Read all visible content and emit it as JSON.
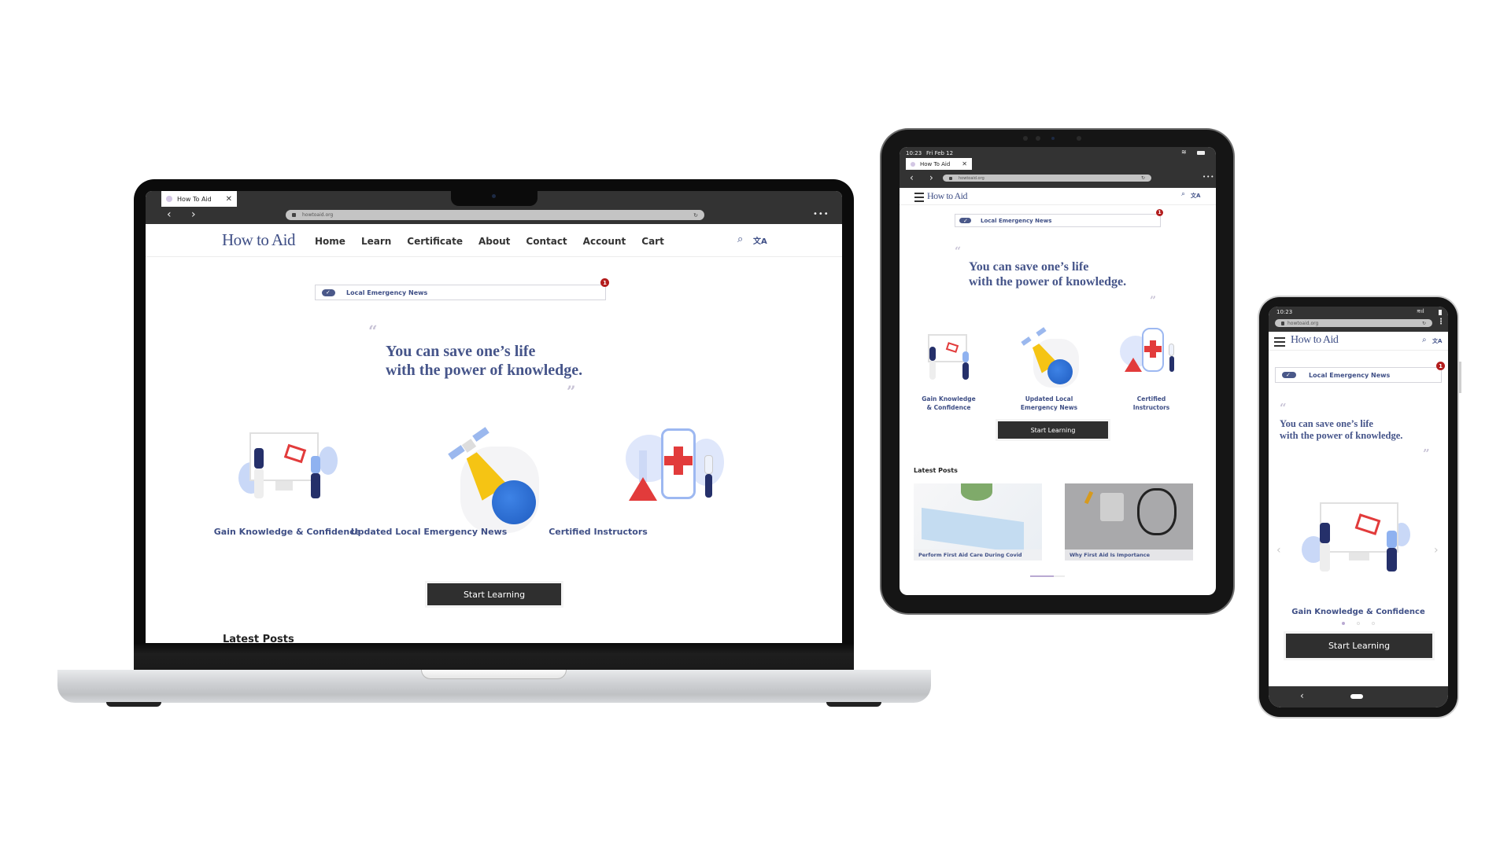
{
  "site": {
    "brand": "How to Aid",
    "tab_title": "How To Aid",
    "url": "howtoaid.org",
    "nav_links": [
      "Home",
      "Learn",
      "Certificate",
      "About",
      "Contact",
      "Account",
      "Cart"
    ],
    "news_label": "Local Emergency News",
    "news_badge_count": "1",
    "quote_open": "“",
    "quote_close": "”",
    "quote_line1": "You can save one’s life",
    "quote_line2": "with the power of knowledge.",
    "features": [
      {
        "label": "Gain Knowledge & Confidence",
        "label_line1": "Gain Knowledge",
        "label_line2": "& Confidence",
        "icon": "students-monitor-illustration"
      },
      {
        "label": "Updated Local Emergency News",
        "label_line1": "Updated Local",
        "label_line2": "Emergency News",
        "icon": "satellite-globe-illustration"
      },
      {
        "label": "Certified Instructors",
        "label_line1": "Certified",
        "label_line2": "Instructors",
        "icon": "medical-phone-illustration"
      }
    ],
    "cta_label": "Start Learning",
    "latest_posts_title": "Latest Posts",
    "posts": [
      {
        "title": "Perform First Aid Care During Covid",
        "image": "face-mask-photo"
      },
      {
        "title": "Why First Aid Is Importance",
        "image": "stethoscope-pills-photo"
      }
    ]
  },
  "tablet": {
    "status_time": "10:23",
    "status_date": "Fri Feb 12"
  },
  "phone": {
    "status_time": "10:23",
    "carousel_active_index": 1,
    "carousel_count": 3
  },
  "glyphs": {
    "back": "‹",
    "forward": "›",
    "close": "✕",
    "more": "•••",
    "search": "⌕",
    "translate": "文A",
    "reload": "↻",
    "kebab": "⋮",
    "prev": "‹",
    "next": "›",
    "android_back": "‹"
  },
  "colors": {
    "brand_navy": "#3f4f86",
    "badge_red": "#b31d1d",
    "button_dark": "#2f2f2f",
    "chrome_dark": "#333333"
  }
}
